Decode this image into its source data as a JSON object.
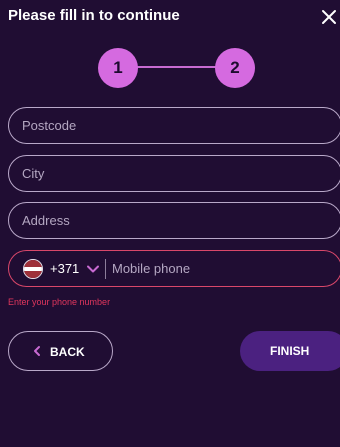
{
  "header": {
    "title": "Please fill in to continue",
    "close_icon": "close-icon"
  },
  "stepper": {
    "steps": [
      "1",
      "2"
    ],
    "active_color": "#d56ae0"
  },
  "form": {
    "postcode": {
      "placeholder": "Postcode",
      "value": ""
    },
    "city": {
      "placeholder": "City",
      "value": ""
    },
    "address": {
      "placeholder": "Address",
      "value": ""
    },
    "phone": {
      "country_flag": "latvia-flag-icon",
      "dial_code": "+371",
      "placeholder": "Mobile phone",
      "value": "",
      "error": "Enter your phone number",
      "error_color": "#e0365d"
    }
  },
  "actions": {
    "back_label": "BACK",
    "finish_label": "FINISH",
    "accent_color": "#4b2180"
  }
}
